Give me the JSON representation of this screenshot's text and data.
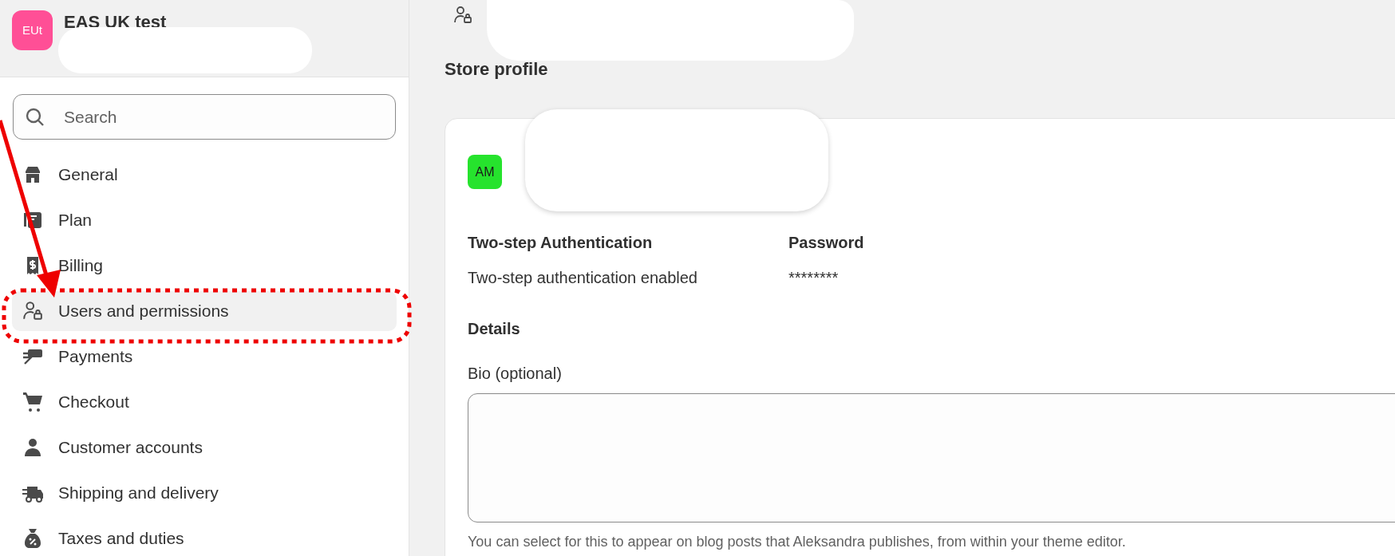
{
  "store": {
    "initials": "EUt",
    "name": "EAS UK test"
  },
  "search": {
    "placeholder": "Search"
  },
  "nav_items": [
    {
      "label": "General",
      "selected": false
    },
    {
      "label": "Plan",
      "selected": false
    },
    {
      "label": "Billing",
      "selected": false
    },
    {
      "label": "Users and permissions",
      "selected": true
    },
    {
      "label": "Payments",
      "selected": false
    },
    {
      "label": "Checkout",
      "selected": false
    },
    {
      "label": "Customer accounts",
      "selected": false
    },
    {
      "label": "Shipping and delivery",
      "selected": false
    },
    {
      "label": "Taxes and duties",
      "selected": false
    }
  ],
  "page": {
    "title": "Store profile"
  },
  "profile": {
    "initials": "AM",
    "color": "#26e32d",
    "security": [
      {
        "label": "Two-step Authentication",
        "value": "Two-step authentication enabled"
      },
      {
        "label": "Password",
        "value": "********"
      }
    ],
    "details": {
      "heading": "Details",
      "bio_label": "Bio (optional)",
      "bio_help": "You can select for this to appear on blog posts that Aleksandra publishes, from within your theme editor."
    }
  }
}
